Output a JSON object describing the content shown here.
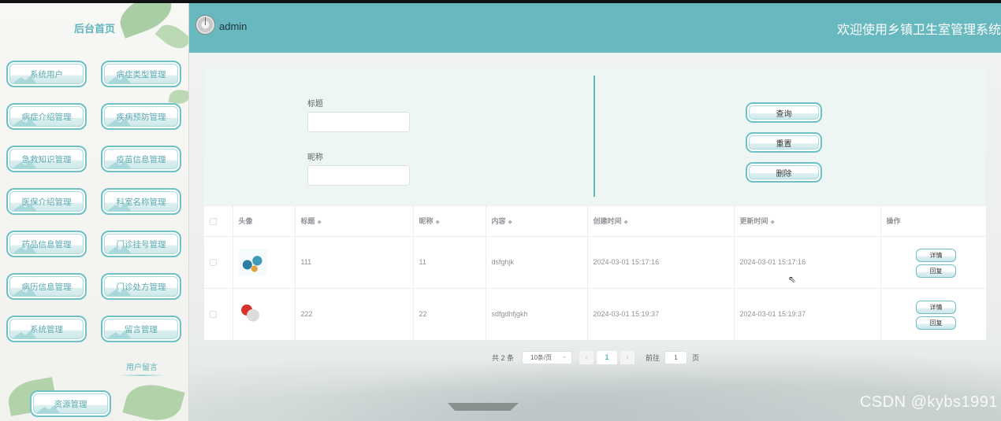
{
  "header": {
    "username": "admin",
    "system_title": "欢迎使用乡镇卫生室管理系统"
  },
  "sidebar": {
    "title": "后台首页",
    "items": [
      {
        "label": "系统用户"
      },
      {
        "label": "病症类型管理"
      },
      {
        "label": "病症介绍管理"
      },
      {
        "label": "疾病预防管理"
      },
      {
        "label": "急救知识管理"
      },
      {
        "label": "疫苗信息管理"
      },
      {
        "label": "医保介绍管理"
      },
      {
        "label": "科室名称管理"
      },
      {
        "label": "药品信息管理"
      },
      {
        "label": "门诊挂号管理"
      },
      {
        "label": "病历信息管理"
      },
      {
        "label": "门诊处方管理"
      },
      {
        "label": "系统管理"
      },
      {
        "label": "留言管理"
      }
    ],
    "sub_item": "用户留言",
    "resource_label": "资源管理"
  },
  "search": {
    "title_label": "标题",
    "title_value": "",
    "nickname_label": "昵称",
    "nickname_value": "",
    "query_button": "查询",
    "reset_button": "重置",
    "delete_button": "删除"
  },
  "table": {
    "headers": {
      "avatar": "头像",
      "title": "标题",
      "nickname": "昵称",
      "content": "内容",
      "created": "创建时间",
      "updated": "更新时间",
      "actions": "操作"
    },
    "rows": [
      {
        "title": "111",
        "nickname": "11",
        "content": "dsfghjk",
        "created": "2024-03-01 15:17:16",
        "updated": "2024-03-01 15:17:16",
        "detail": "详情",
        "reply": "回复"
      },
      {
        "title": "222",
        "nickname": "22",
        "content": "sdfgdhfjgkh",
        "created": "2024-03-01 15:19:37",
        "updated": "2024-03-01 15:19:37",
        "detail": "详情",
        "reply": "回复"
      }
    ]
  },
  "pagination": {
    "total_text": "共 2 条",
    "page_size": "10条/页",
    "prev_icon": "‹",
    "current_page": "1",
    "next_icon": "›",
    "goto_label": "前往",
    "goto_value": "1",
    "page_unit": "页"
  },
  "watermark": "CSDN @kybs1991",
  "colors": {
    "accent": "#67b8bf",
    "button_border": "#6fc1c8"
  }
}
